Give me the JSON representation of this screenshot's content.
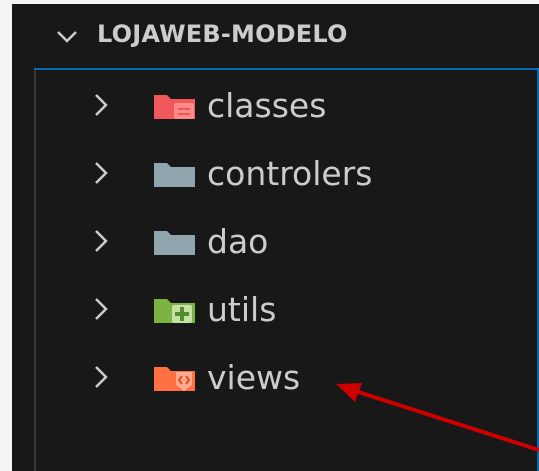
{
  "explorer": {
    "project_title": "LOJAWEB-MODELO",
    "items": [
      {
        "label": "classes",
        "icon": "folder-classes-icon",
        "color": "#f0585b"
      },
      {
        "label": "controlers",
        "icon": "folder-icon",
        "color": "#90a4ae"
      },
      {
        "label": "dao",
        "icon": "folder-icon",
        "color": "#90a4ae"
      },
      {
        "label": "utils",
        "icon": "folder-utils-icon",
        "color": "#7cb342"
      },
      {
        "label": "views",
        "icon": "folder-views-icon",
        "color": "#ff7043"
      }
    ]
  },
  "colors": {
    "background": "#181818",
    "text": "#cccccc",
    "annotation_arrow": "#cc0000"
  }
}
